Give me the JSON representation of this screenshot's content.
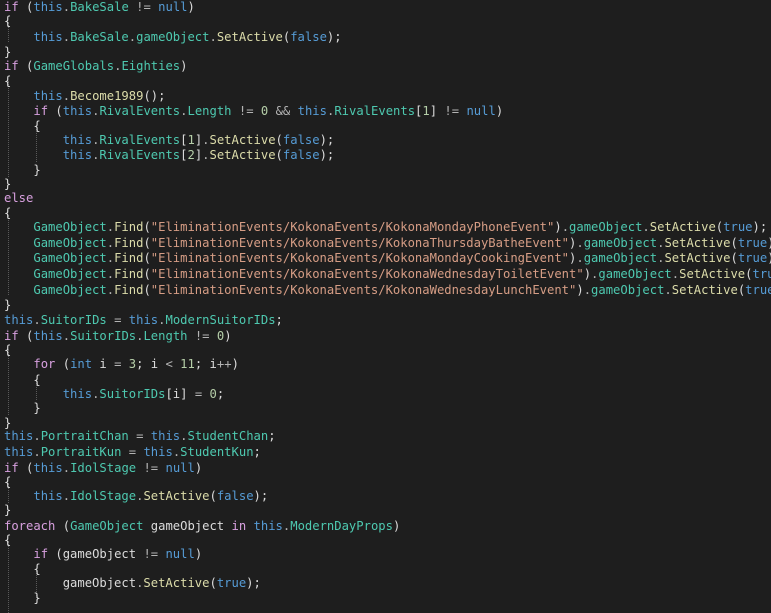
{
  "colors": {
    "background": "#1e1e1e",
    "keyword": "#569cd6",
    "type": "#4ec9b0",
    "member": "#4ec9b0",
    "method": "#dcdcaa",
    "control": "#d8a0df",
    "string": "#d69d85",
    "number": "#b5cea8",
    "plain": "#dcdcdc",
    "operator": "#b4b4b4"
  },
  "code": {
    "lines": [
      [
        [
          "ctl",
          "if"
        ],
        [
          "plain",
          " ("
        ],
        [
          "kw",
          "this"
        ],
        [
          "op",
          "."
        ],
        [
          "mem",
          "BakeSale"
        ],
        [
          "plain",
          " "
        ],
        [
          "op",
          "!="
        ],
        [
          "plain",
          " "
        ],
        [
          "kw",
          "null"
        ],
        [
          "plain",
          ")"
        ]
      ],
      [
        [
          "plain",
          "{"
        ]
      ],
      [
        [
          "plain",
          "    "
        ],
        [
          "kw",
          "this"
        ],
        [
          "op",
          "."
        ],
        [
          "mem",
          "BakeSale"
        ],
        [
          "op",
          "."
        ],
        [
          "mem",
          "gameObject"
        ],
        [
          "op",
          "."
        ],
        [
          "meth",
          "SetActive"
        ],
        [
          "plain",
          "("
        ],
        [
          "kw",
          "false"
        ],
        [
          "plain",
          ");"
        ]
      ],
      [
        [
          "plain",
          "}"
        ]
      ],
      [
        [
          "ctl",
          "if"
        ],
        [
          "plain",
          " ("
        ],
        [
          "type",
          "GameGlobals"
        ],
        [
          "op",
          "."
        ],
        [
          "mem",
          "Eighties"
        ],
        [
          "plain",
          ")"
        ]
      ],
      [
        [
          "plain",
          "{"
        ]
      ],
      [
        [
          "plain",
          "    "
        ],
        [
          "kw",
          "this"
        ],
        [
          "op",
          "."
        ],
        [
          "meth",
          "Become1989"
        ],
        [
          "plain",
          "();"
        ]
      ],
      [
        [
          "plain",
          "    "
        ],
        [
          "ctl",
          "if"
        ],
        [
          "plain",
          " ("
        ],
        [
          "kw",
          "this"
        ],
        [
          "op",
          "."
        ],
        [
          "mem",
          "RivalEvents"
        ],
        [
          "op",
          "."
        ],
        [
          "mem",
          "Length"
        ],
        [
          "plain",
          " "
        ],
        [
          "op",
          "!="
        ],
        [
          "plain",
          " "
        ],
        [
          "num",
          "0"
        ],
        [
          "plain",
          " "
        ],
        [
          "op",
          "&&"
        ],
        [
          "plain",
          " "
        ],
        [
          "kw",
          "this"
        ],
        [
          "op",
          "."
        ],
        [
          "mem",
          "RivalEvents"
        ],
        [
          "plain",
          "["
        ],
        [
          "num",
          "1"
        ],
        [
          "plain",
          "] "
        ],
        [
          "op",
          "!="
        ],
        [
          "plain",
          " "
        ],
        [
          "kw",
          "null"
        ],
        [
          "plain",
          ")"
        ]
      ],
      [
        [
          "plain",
          "    {"
        ]
      ],
      [
        [
          "plain",
          "        "
        ],
        [
          "kw",
          "this"
        ],
        [
          "op",
          "."
        ],
        [
          "mem",
          "RivalEvents"
        ],
        [
          "plain",
          "["
        ],
        [
          "num",
          "1"
        ],
        [
          "plain",
          "]"
        ],
        [
          "op",
          "."
        ],
        [
          "meth",
          "SetActive"
        ],
        [
          "plain",
          "("
        ],
        [
          "kw",
          "false"
        ],
        [
          "plain",
          ");"
        ]
      ],
      [
        [
          "plain",
          "        "
        ],
        [
          "kw",
          "this"
        ],
        [
          "op",
          "."
        ],
        [
          "mem",
          "RivalEvents"
        ],
        [
          "plain",
          "["
        ],
        [
          "num",
          "2"
        ],
        [
          "plain",
          "]"
        ],
        [
          "op",
          "."
        ],
        [
          "meth",
          "SetActive"
        ],
        [
          "plain",
          "("
        ],
        [
          "kw",
          "false"
        ],
        [
          "plain",
          ");"
        ]
      ],
      [
        [
          "plain",
          "    }"
        ]
      ],
      [
        [
          "plain",
          "}"
        ]
      ],
      [
        [
          "ctl",
          "else"
        ]
      ],
      [
        [
          "plain",
          "{"
        ]
      ],
      [
        [
          "plain",
          "    "
        ],
        [
          "type",
          "GameObject"
        ],
        [
          "op",
          "."
        ],
        [
          "meth",
          "Find"
        ],
        [
          "plain",
          "("
        ],
        [
          "str",
          "\"EliminationEvents/KokonaEvents/KokonaMondayPhoneEvent\""
        ],
        [
          "plain",
          ")"
        ],
        [
          "op",
          "."
        ],
        [
          "mem",
          "gameObject"
        ],
        [
          "op",
          "."
        ],
        [
          "meth",
          "SetActive"
        ],
        [
          "plain",
          "("
        ],
        [
          "kw",
          "true"
        ],
        [
          "plain",
          ");"
        ]
      ],
      [
        [
          "plain",
          "    "
        ],
        [
          "type",
          "GameObject"
        ],
        [
          "op",
          "."
        ],
        [
          "meth",
          "Find"
        ],
        [
          "plain",
          "("
        ],
        [
          "str",
          "\"EliminationEvents/KokonaEvents/KokonaThursdayBatheEvent\""
        ],
        [
          "plain",
          ")"
        ],
        [
          "op",
          "."
        ],
        [
          "mem",
          "gameObject"
        ],
        [
          "op",
          "."
        ],
        [
          "meth",
          "SetActive"
        ],
        [
          "plain",
          "("
        ],
        [
          "kw",
          "true"
        ],
        [
          "plain",
          ");"
        ]
      ],
      [
        [
          "plain",
          "    "
        ],
        [
          "type",
          "GameObject"
        ],
        [
          "op",
          "."
        ],
        [
          "meth",
          "Find"
        ],
        [
          "plain",
          "("
        ],
        [
          "str",
          "\"EliminationEvents/KokonaEvents/KokonaMondayCookingEvent\""
        ],
        [
          "plain",
          ")"
        ],
        [
          "op",
          "."
        ],
        [
          "mem",
          "gameObject"
        ],
        [
          "op",
          "."
        ],
        [
          "meth",
          "SetActive"
        ],
        [
          "plain",
          "("
        ],
        [
          "kw",
          "true"
        ],
        [
          "plain",
          ");"
        ]
      ],
      [
        [
          "plain",
          "    "
        ],
        [
          "type",
          "GameObject"
        ],
        [
          "op",
          "."
        ],
        [
          "meth",
          "Find"
        ],
        [
          "plain",
          "("
        ],
        [
          "str",
          "\"EliminationEvents/KokonaEvents/KokonaWednesdayToiletEvent\""
        ],
        [
          "plain",
          ")"
        ],
        [
          "op",
          "."
        ],
        [
          "mem",
          "gameObject"
        ],
        [
          "op",
          "."
        ],
        [
          "meth",
          "SetActive"
        ],
        [
          "plain",
          "("
        ],
        [
          "kw",
          "true"
        ],
        [
          "plain",
          ");"
        ]
      ],
      [
        [
          "plain",
          "    "
        ],
        [
          "type",
          "GameObject"
        ],
        [
          "op",
          "."
        ],
        [
          "meth",
          "Find"
        ],
        [
          "plain",
          "("
        ],
        [
          "str",
          "\"EliminationEvents/KokonaEvents/KokonaWednesdayLunchEvent\""
        ],
        [
          "plain",
          ")"
        ],
        [
          "op",
          "."
        ],
        [
          "mem",
          "gameObject"
        ],
        [
          "op",
          "."
        ],
        [
          "meth",
          "SetActive"
        ],
        [
          "plain",
          "("
        ],
        [
          "kw",
          "true"
        ],
        [
          "plain",
          ");"
        ]
      ],
      [
        [
          "plain",
          "}"
        ]
      ],
      [
        [
          "kw",
          "this"
        ],
        [
          "op",
          "."
        ],
        [
          "mem",
          "SuitorIDs"
        ],
        [
          "plain",
          " "
        ],
        [
          "op",
          "="
        ],
        [
          "plain",
          " "
        ],
        [
          "kw",
          "this"
        ],
        [
          "op",
          "."
        ],
        [
          "mem",
          "ModernSuitorIDs"
        ],
        [
          "plain",
          ";"
        ]
      ],
      [
        [
          "ctl",
          "if"
        ],
        [
          "plain",
          " ("
        ],
        [
          "kw",
          "this"
        ],
        [
          "op",
          "."
        ],
        [
          "mem",
          "SuitorIDs"
        ],
        [
          "op",
          "."
        ],
        [
          "mem",
          "Length"
        ],
        [
          "plain",
          " "
        ],
        [
          "op",
          "!="
        ],
        [
          "plain",
          " "
        ],
        [
          "num",
          "0"
        ],
        [
          "plain",
          ")"
        ]
      ],
      [
        [
          "plain",
          "{"
        ]
      ],
      [
        [
          "plain",
          "    "
        ],
        [
          "ctl",
          "for"
        ],
        [
          "plain",
          " ("
        ],
        [
          "kw",
          "int"
        ],
        [
          "plain",
          " i "
        ],
        [
          "op",
          "="
        ],
        [
          "plain",
          " "
        ],
        [
          "num",
          "3"
        ],
        [
          "plain",
          "; i "
        ],
        [
          "op",
          "<"
        ],
        [
          "plain",
          " "
        ],
        [
          "num",
          "11"
        ],
        [
          "plain",
          "; i"
        ],
        [
          "op",
          "++"
        ],
        [
          "plain",
          ")"
        ]
      ],
      [
        [
          "plain",
          "    {"
        ]
      ],
      [
        [
          "plain",
          "        "
        ],
        [
          "kw",
          "this"
        ],
        [
          "op",
          "."
        ],
        [
          "mem",
          "SuitorIDs"
        ],
        [
          "plain",
          "[i] "
        ],
        [
          "op",
          "="
        ],
        [
          "plain",
          " "
        ],
        [
          "num",
          "0"
        ],
        [
          "plain",
          ";"
        ]
      ],
      [
        [
          "plain",
          "    }"
        ]
      ],
      [
        [
          "plain",
          "}"
        ]
      ],
      [
        [
          "kw",
          "this"
        ],
        [
          "op",
          "."
        ],
        [
          "mem",
          "PortraitChan"
        ],
        [
          "plain",
          " "
        ],
        [
          "op",
          "="
        ],
        [
          "plain",
          " "
        ],
        [
          "kw",
          "this"
        ],
        [
          "op",
          "."
        ],
        [
          "mem",
          "StudentChan"
        ],
        [
          "plain",
          ";"
        ]
      ],
      [
        [
          "kw",
          "this"
        ],
        [
          "op",
          "."
        ],
        [
          "mem",
          "PortraitKun"
        ],
        [
          "plain",
          " "
        ],
        [
          "op",
          "="
        ],
        [
          "plain",
          " "
        ],
        [
          "kw",
          "this"
        ],
        [
          "op",
          "."
        ],
        [
          "mem",
          "StudentKun"
        ],
        [
          "plain",
          ";"
        ]
      ],
      [
        [
          "ctl",
          "if"
        ],
        [
          "plain",
          " ("
        ],
        [
          "kw",
          "this"
        ],
        [
          "op",
          "."
        ],
        [
          "mem",
          "IdolStage"
        ],
        [
          "plain",
          " "
        ],
        [
          "op",
          "!="
        ],
        [
          "plain",
          " "
        ],
        [
          "kw",
          "null"
        ],
        [
          "plain",
          ")"
        ]
      ],
      [
        [
          "plain",
          "{"
        ]
      ],
      [
        [
          "plain",
          "    "
        ],
        [
          "kw",
          "this"
        ],
        [
          "op",
          "."
        ],
        [
          "mem",
          "IdolStage"
        ],
        [
          "op",
          "."
        ],
        [
          "meth",
          "SetActive"
        ],
        [
          "plain",
          "("
        ],
        [
          "kw",
          "false"
        ],
        [
          "plain",
          ");"
        ]
      ],
      [
        [
          "plain",
          "}"
        ]
      ],
      [
        [
          "ctl",
          "foreach"
        ],
        [
          "plain",
          " ("
        ],
        [
          "type",
          "GameObject"
        ],
        [
          "plain",
          " gameObject "
        ],
        [
          "ctl",
          "in"
        ],
        [
          "plain",
          " "
        ],
        [
          "kw",
          "this"
        ],
        [
          "op",
          "."
        ],
        [
          "mem",
          "ModernDayProps"
        ],
        [
          "plain",
          ")"
        ]
      ],
      [
        [
          "plain",
          "{"
        ]
      ],
      [
        [
          "plain",
          "    "
        ],
        [
          "ctl",
          "if"
        ],
        [
          "plain",
          " (gameObject "
        ],
        [
          "op",
          "!="
        ],
        [
          "plain",
          " "
        ],
        [
          "kw",
          "null"
        ],
        [
          "plain",
          ")"
        ]
      ],
      [
        [
          "plain",
          "    {"
        ]
      ],
      [
        [
          "plain",
          "        gameObject"
        ],
        [
          "op",
          "."
        ],
        [
          "meth",
          "SetActive"
        ],
        [
          "plain",
          "("
        ],
        [
          "kw",
          "true"
        ],
        [
          "plain",
          ");"
        ]
      ],
      [
        [
          "plain",
          "    }"
        ]
      ]
    ]
  }
}
